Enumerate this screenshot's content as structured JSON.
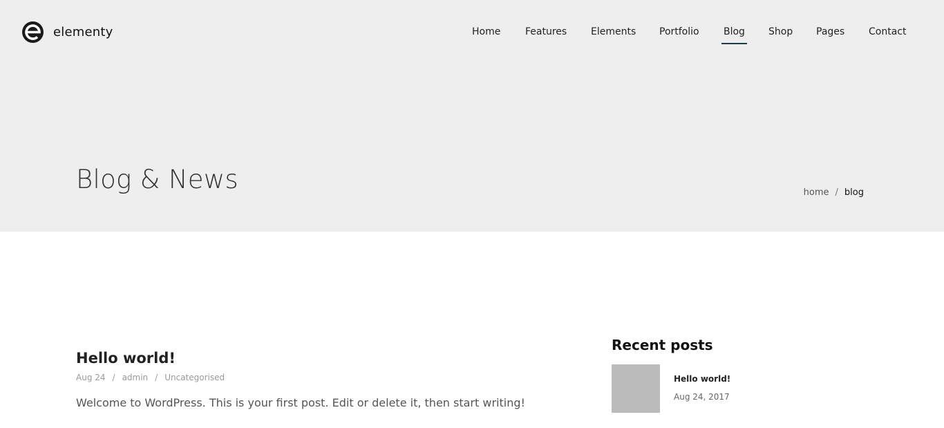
{
  "brand": {
    "name": "elementy",
    "logo_icon": "e-logo-icon"
  },
  "nav": {
    "items": [
      {
        "label": "Home"
      },
      {
        "label": "Features"
      },
      {
        "label": "Elements"
      },
      {
        "label": "Portfolio"
      },
      {
        "label": "Blog",
        "active": true
      },
      {
        "label": "Shop"
      },
      {
        "label": "Pages"
      },
      {
        "label": "Contact"
      }
    ]
  },
  "hero": {
    "title": "Blog & News",
    "breadcrumb": {
      "home": "home",
      "separator": "/",
      "current": "blog"
    }
  },
  "post": {
    "title": "Hello world!",
    "date": "Aug 24",
    "author": "admin",
    "category": "Uncategorised",
    "meta_separator": "/",
    "excerpt": "Welcome to WordPress. This is your first post. Edit or delete it, then start writing!"
  },
  "sidebar": {
    "recent_posts_title": "Recent posts",
    "recent_posts": [
      {
        "title": "Hello world!",
        "date": "Aug 24, 2017"
      }
    ]
  },
  "colors": {
    "hero_bg": "#eeeeee",
    "accent": "#1f3d44",
    "thumb_placeholder": "#bbbbbb"
  }
}
